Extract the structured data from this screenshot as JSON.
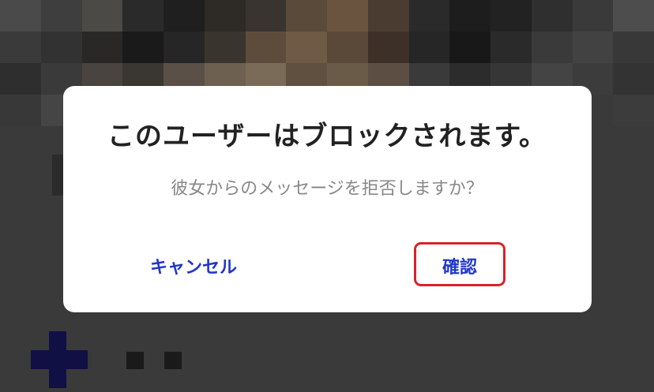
{
  "dialog": {
    "title": "このユーザーはブロックされます。",
    "message": "彼女からのメッセージを拒否しますか？",
    "cancel_label": "キャンセル",
    "confirm_label": "確認"
  },
  "colors": {
    "button_text": "#2137c8",
    "highlight_border": "#d8222a",
    "title_text": "#222222",
    "message_text": "#888888"
  }
}
